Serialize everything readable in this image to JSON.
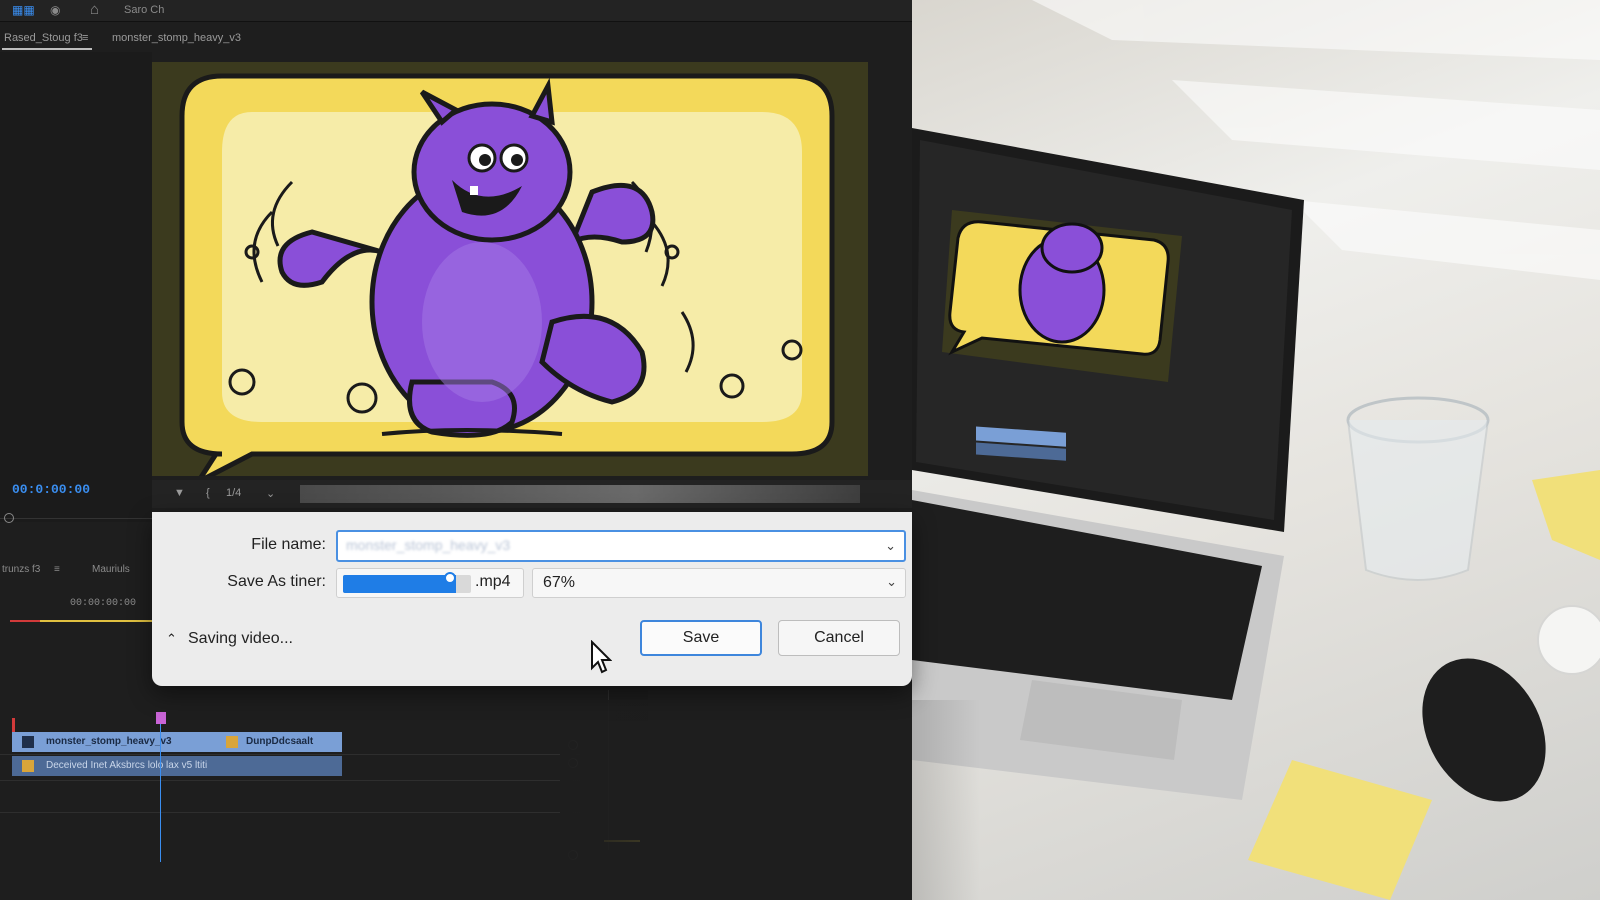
{
  "topbar": {
    "title": "Saro Ch"
  },
  "tabs": [
    {
      "label": "Rased_Stoug f3"
    },
    {
      "label": "monster_stomp_heavy_v3"
    }
  ],
  "program": {
    "timecode": "00:0:00:00",
    "zoom": "1/4"
  },
  "timeline": {
    "tabs": [
      {
        "label": "trunzs f3"
      },
      {
        "label": "Mauriuls"
      }
    ],
    "timecode": "00:00:00:00",
    "clips": [
      {
        "label": "monster_stomp_heavy_v3"
      },
      {
        "label": "DunpDdcsaalt"
      },
      {
        "label": "Deceived Inet Aksbrcs lolo lax v5 ltiti"
      }
    ]
  },
  "dialog": {
    "file_name_label": "File name:",
    "file_name_value": "monster_stomp_heavy_v3",
    "save_as_label": "Save As tiner:",
    "progress": 0.88,
    "extension": ".mp4",
    "percent": "67%",
    "status": "Saving video...",
    "save_label": "Save",
    "cancel_label": "Cancel"
  },
  "colors": {
    "accent": "#1f7de6",
    "monster": "#8a4fd8",
    "bubble": "#f3d95a",
    "timecode": "#3a8ef0"
  },
  "icons": [
    "home-icon",
    "chevron-down-icon",
    "chevron-up-icon",
    "cursor-icon"
  ]
}
